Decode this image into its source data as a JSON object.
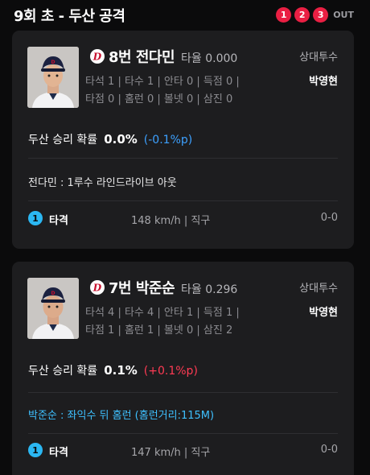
{
  "header": {
    "title": "9회 초 - 두산 공격",
    "outs": [
      "1",
      "2",
      "3"
    ],
    "out_label": "OUT"
  },
  "cards": [
    {
      "batter": "8번 전다민",
      "avg": "타율 0.000",
      "stats_line1": "타석 1 | 타수 1 | 안타 0 | 득점 0 |",
      "stats_line2": "타점 0 | 홈런 0 | 볼넷 0 | 삼진 0",
      "opp_label": "상대투수",
      "opp_pitcher": "박영현",
      "prob_label": "두산 승리 확률",
      "prob_value": "0.0%",
      "prob_change": "(-0.1%p)",
      "result": "전다민 : 1루수 라인드라이브 아웃",
      "pitch": {
        "num": "1",
        "type": "타격",
        "info": "148 km/h | 직구",
        "count": "0-0"
      }
    },
    {
      "batter": "7번 박준순",
      "avg": "타율 0.296",
      "stats_line1": "타석 4 | 타수 4 | 안타 1 | 득점 1 |",
      "stats_line2": "타점 1 | 홈런 1 | 볼넷 0 | 삼진 2",
      "opp_label": "상대투수",
      "opp_pitcher": "박영현",
      "prob_label": "두산 승리 확률",
      "prob_value": "0.1%",
      "prob_change": "(+0.1%p)",
      "result": "박준순 : 좌익수 뒤 홈런 (홈런거리:115M)",
      "pitch": {
        "num": "1",
        "type": "타격",
        "info": "147 km/h | 직구",
        "count": "0-0"
      }
    }
  ],
  "colors": {
    "out_dot": "#ea1f43",
    "prob_decrease": "#3da1ff",
    "prob_increase": "#ff3b54",
    "homerun_text": "#3ec0ff",
    "pitch_badge": "#2bb7f2"
  }
}
